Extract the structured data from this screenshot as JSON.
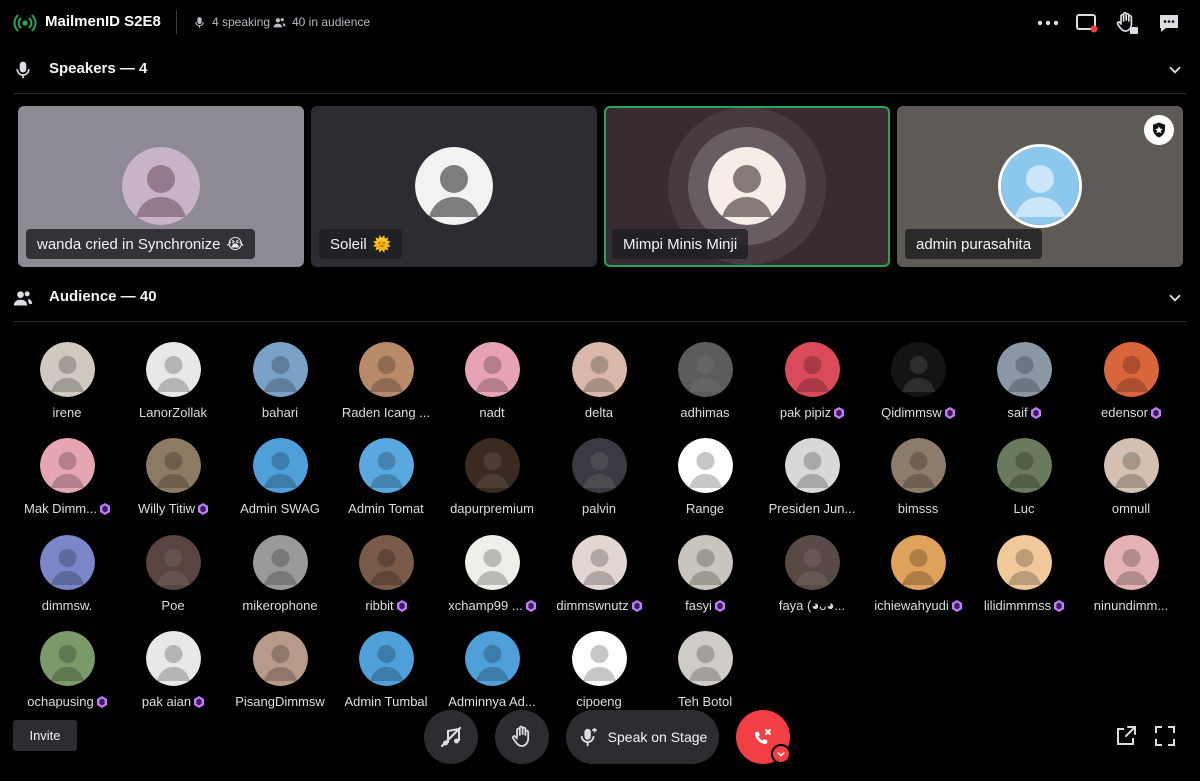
{
  "header": {
    "title": "MailmenID S2E8",
    "speaking": "4 speaking",
    "audience_count": "40 in audience"
  },
  "speakers": {
    "label": "Speakers — 4",
    "tiles": [
      {
        "name": "wanda cried in Synchronize",
        "emoji": "😭",
        "bg": "#8e8a93",
        "active": false
      },
      {
        "name": "Soleil",
        "emoji": "🌞",
        "bg": "#2b2d33",
        "active": false
      },
      {
        "name": "Mimpi Minis Minji",
        "emoji": "",
        "bg": "#3a2a32",
        "active": true
      },
      {
        "name": "admin purasahita",
        "emoji": "",
        "bg": "#5e5a55",
        "active": false
      }
    ]
  },
  "audience": {
    "label": "Audience — 40",
    "members": [
      {
        "name": "irene",
        "boost": false,
        "color": "#cfc9c0"
      },
      {
        "name": "LanorZollak",
        "boost": false,
        "color": "#e8e8e8"
      },
      {
        "name": "bahari",
        "boost": false,
        "color": "#7aa2c9"
      },
      {
        "name": "Raden Icang ...",
        "boost": false,
        "color": "#b88a6a"
      },
      {
        "name": "nadt",
        "boost": false,
        "color": "#e7a2b5"
      },
      {
        "name": "delta",
        "boost": false,
        "color": "#d9b8aa"
      },
      {
        "name": "adhimas",
        "boost": false,
        "color": "#5c5c5c"
      },
      {
        "name": "pak pipiz",
        "boost": true,
        "color": "#d94a5a"
      },
      {
        "name": "Qidimmsw",
        "boost": true,
        "color": "#141414"
      },
      {
        "name": "saif",
        "boost": true,
        "color": "#8a98a5"
      },
      {
        "name": "edensor",
        "boost": true,
        "color": "#d9663b"
      },
      {
        "name": "Mak Dimm...",
        "boost": true,
        "color": "#e6a5b3"
      },
      {
        "name": "Willy Titiw",
        "boost": true,
        "color": "#8c7a62"
      },
      {
        "name": "Admin SWAG",
        "boost": false,
        "color": "#4f9fd9"
      },
      {
        "name": "Admin Tomat",
        "boost": false,
        "color": "#59a9e0"
      },
      {
        "name": "dapurpremium",
        "boost": false,
        "color": "#3b2a20"
      },
      {
        "name": "palvin",
        "boost": false,
        "color": "#3a3a42"
      },
      {
        "name": "Range",
        "boost": false,
        "color": "#ffffff"
      },
      {
        "name": "Presiden Jun...",
        "boost": false,
        "color": "#d8d8d8"
      },
      {
        "name": "bimsss",
        "boost": false,
        "color": "#8e7c6a"
      },
      {
        "name": "Luc",
        "boost": false,
        "color": "#6a7a5c"
      },
      {
        "name": "omnull",
        "boost": false,
        "color": "#d3c0b0"
      },
      {
        "name": "dimmsw.",
        "boost": false,
        "color": "#7a86c8"
      },
      {
        "name": "Poe",
        "boost": false,
        "color": "#5a4440"
      },
      {
        "name": "mikerophone",
        "boost": false,
        "color": "#9a9a9a"
      },
      {
        "name": "ribbit",
        "boost": true,
        "color": "#7a5a48"
      },
      {
        "name": "xchamp99 ...",
        "boost": true,
        "color": "#f0eee8"
      },
      {
        "name": "dimmswnutz",
        "boost": true,
        "color": "#e2d6d2"
      },
      {
        "name": "fasyi",
        "boost": true,
        "color": "#c9c4bd"
      },
      {
        "name": "faya (◕ᴗ◕...",
        "boost": false,
        "color": "#5a4a46"
      },
      {
        "name": "ichiewahyudi",
        "boost": true,
        "color": "#e0a25a"
      },
      {
        "name": "lilidimmmss",
        "boost": true,
        "color": "#f0c89a"
      },
      {
        "name": "ninundimm...",
        "boost": false,
        "color": "#e4b2b4"
      },
      {
        "name": "ochapusing",
        "boost": true,
        "color": "#7a9a6a"
      },
      {
        "name": "pak aian",
        "boost": true,
        "color": "#e8e8e8"
      },
      {
        "name": "PisangDimmsw",
        "boost": false,
        "color": "#b89a8a"
      },
      {
        "name": "Admin Tumbal",
        "boost": false,
        "color": "#4f9fd9"
      },
      {
        "name": "Adminnya Ad...",
        "boost": false,
        "color": "#4f9fd9"
      },
      {
        "name": "cipoeng",
        "boost": false,
        "color": "#ffffff"
      },
      {
        "name": "Teh Botol",
        "boost": false,
        "color": "#d0ccc8"
      }
    ]
  },
  "controls": {
    "invite_label": "Invite",
    "speak_label": "Speak on Stage"
  },
  "colors": {
    "accent_green": "#23a55a",
    "danger": "#f23f43",
    "boost": "#c27cff"
  }
}
